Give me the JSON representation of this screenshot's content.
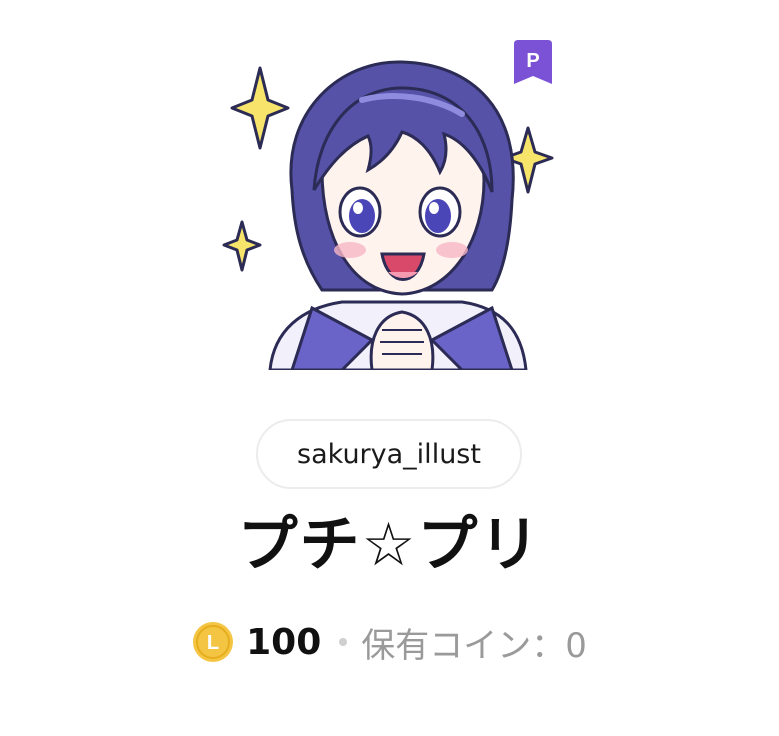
{
  "sticker": {
    "image_name": "anime-girl-sticker",
    "premium_badge_letter": "P"
  },
  "author": {
    "name": "sakurya_illust"
  },
  "title": "プチ☆プリ",
  "price": {
    "coin_letter": "L",
    "amount": "100",
    "owned_label": "保有コイン：0"
  },
  "colors": {
    "hair": "#5552a8",
    "hair_dark": "#3f3c8c",
    "badge": "#7b52d6",
    "coin": "#f4c542",
    "sparkle": "#f7e46b",
    "uniform": "#6a64c8"
  }
}
